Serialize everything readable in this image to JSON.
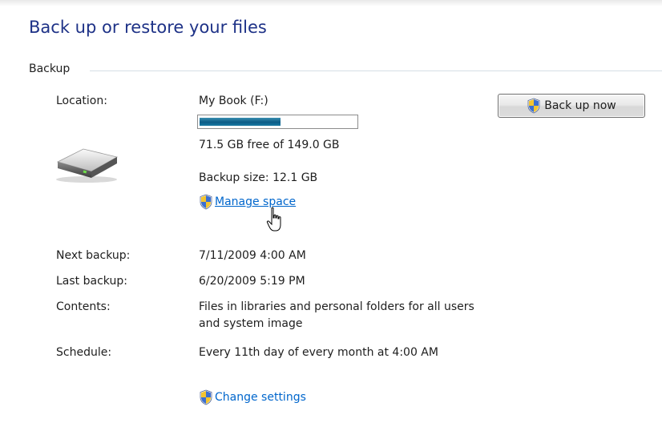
{
  "page": {
    "title": "Back up or restore your files"
  },
  "backup": {
    "section_label": "Backup",
    "location_label": "Location:",
    "location_value": "My Book (F:)",
    "space_used_fraction": 0.52,
    "free_space_text": "71.5 GB free of 149.0 GB",
    "backup_size_text": "Backup size: 12.1 GB",
    "manage_space_link": "Manage space",
    "back_up_now_button": "Back up now",
    "next_backup_label": "Next backup:",
    "next_backup_value": "7/11/2009 4:00 AM",
    "last_backup_label": "Last backup:",
    "last_backup_value": "6/20/2009 5:19 PM",
    "contents_label": "Contents:",
    "contents_value": "Files in libraries and personal folders for all users and system image",
    "schedule_label": "Schedule:",
    "schedule_value": "Every 11th day of every month at 4:00 AM",
    "change_settings_link": "Change settings"
  },
  "icons": {
    "drive": "hard-drive-icon",
    "shield": "uac-shield-icon",
    "cursor": "hand-pointer-cursor-icon"
  },
  "colors": {
    "title": "#1e3287",
    "link": "#0066cc",
    "progress_fill": "#0c5c86",
    "section_line": "#d5dfe5"
  }
}
